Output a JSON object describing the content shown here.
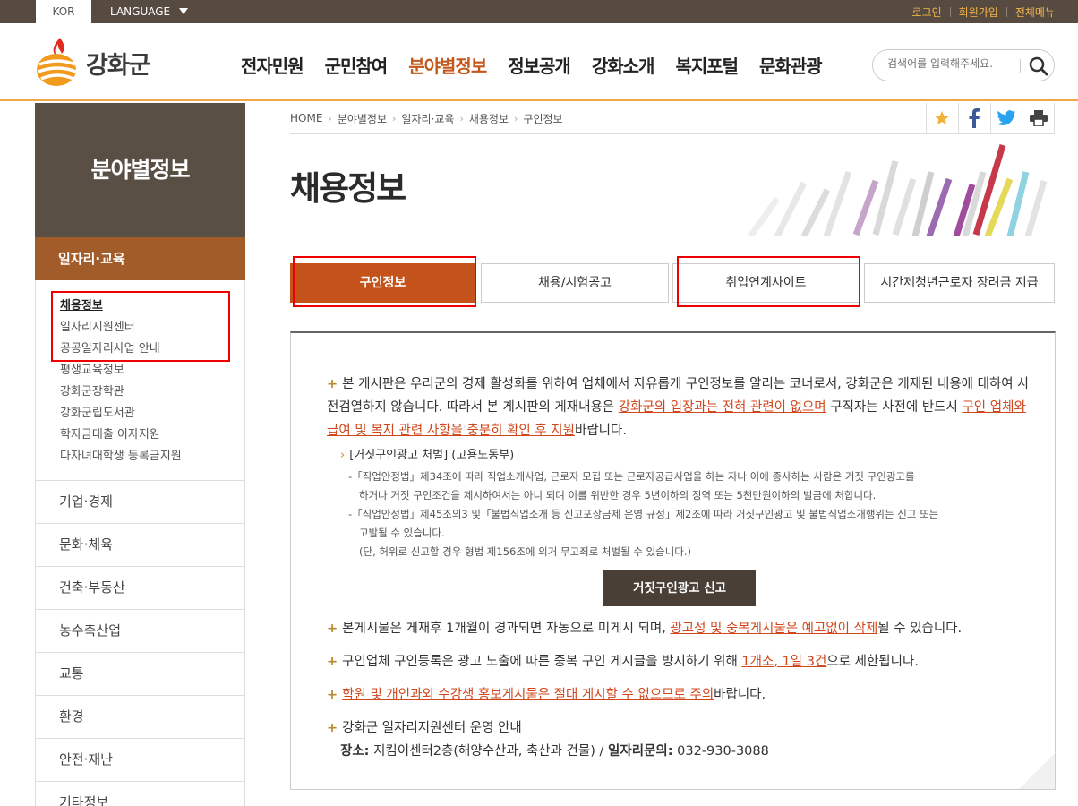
{
  "topbar": {
    "kor": "KOR",
    "language": "LANGUAGE",
    "util_links": [
      "로그인",
      "회원가입",
      "전체메뉴"
    ]
  },
  "header": {
    "logo_text": "강화군",
    "gnb": [
      "전자민원",
      "군민참여",
      "분야별정보",
      "정보공개",
      "강화소개",
      "복지포털",
      "문화관광"
    ],
    "gnb_active": "분야별정보",
    "search_placeholder": "검색어를 입력해주세요."
  },
  "sidebar": {
    "title": "분야별정보",
    "current": "일자리·교육",
    "sub_items": [
      "채용정보",
      "일자리지원센터",
      "공공일자리사업 안내",
      "평생교육정보",
      "강화군장학관",
      "강화군립도서관",
      "학자금대출 이자지원",
      "다자녀대학생 등록금지원"
    ],
    "items": [
      "기업·경제",
      "문화·체육",
      "건축·부동산",
      "농수축산업",
      "교통",
      "환경",
      "안전·재난",
      "기타정보"
    ]
  },
  "breadcrumb": [
    "HOME",
    "분야별정보",
    "일자리·교육",
    "채용정보",
    "구인정보"
  ],
  "share_icons": [
    "star-icon",
    "facebook-icon",
    "twitter-icon",
    "print-icon"
  ],
  "page_title": "채용정보",
  "tabs": [
    "구인정보",
    "채용/시험공고",
    "취업연계사이트",
    "시간제청년근로자 장려금 지급"
  ],
  "notice": {
    "p1_a": "본 게시판은 우리군의 경제 활성화를 위하여 업체에서 자유롭게 구인정보를 알리는 코너로서, 강화군은 게재된 내용에 대하여 사전검열하지 않습니다. 따라서 본 게시판의 게재내용은 ",
    "p1_hl1": "강화군의 입장과는 전혀 관련이 없으며",
    "p1_b": " 구직자는 사전에 반드시 ",
    "p1_hl2": "구인 업체와 급여 및 복지 관련 사항을 충분히 확인 후 지원",
    "p1_c": "바랍니다.",
    "sub_head": "[거짓구인광고 처벌] (고용노동부)",
    "law1_l1": "-「직업안정법」제34조에 따라 직업소개사업, 근로자 모집 또는 근로자공급사업을 하는 자나 이에 종사하는 사람은 거짓 구인광고를",
    "law1_l2": "하거나 거짓 구인조건을 제시하여서는 아니 되며 이를 위반한 경우 5년이하의 징역 또는 5천만원이하의 벌금에 처합니다.",
    "law2_l1": "-「직업안정법」제45조의3 및「불법직업소개 등 신고포상금제 운영 규정」제2조에 따라 거짓구인광고 및 불법직업소개행위는 신고 또는",
    "law2_l2": "고발될 수 있습니다.",
    "law2_l3": "(단, 허위로 신고할 경우 형법 제156조에 의거 무고죄로 처벌될 수 있습니다.)",
    "report_button": "거짓구인광고 신고",
    "p2_a": "본게시물은 게재후 1개월이 경과되면 자동으로 미게시 되며, ",
    "p2_hl": "광고성 및 중복게시물은 예고없이 삭제",
    "p2_b": "될 수 있습니다.",
    "p3_a": "구인업체 구인등록은 광고 노출에 따른 중복 구인 게시글을 방지하기 위해 ",
    "p3_hl": "1개소, 1일 3건",
    "p3_b": "으로 제한됩니다.",
    "p4_hl": "학원 및 개인과외 수강생 홍보게시물은 절대 게시할 수 없으므로 주의",
    "p4_b": "바랍니다.",
    "p5_title": "강화군 일자리지원센터 운영 안내",
    "p5_place_label": "장소:",
    "p5_place": " 지킴이센터2층(해양수산과, 축산과 건물) / ",
    "p5_phone_label": "일자리문의:",
    "p5_phone": " 032-930-3088"
  }
}
